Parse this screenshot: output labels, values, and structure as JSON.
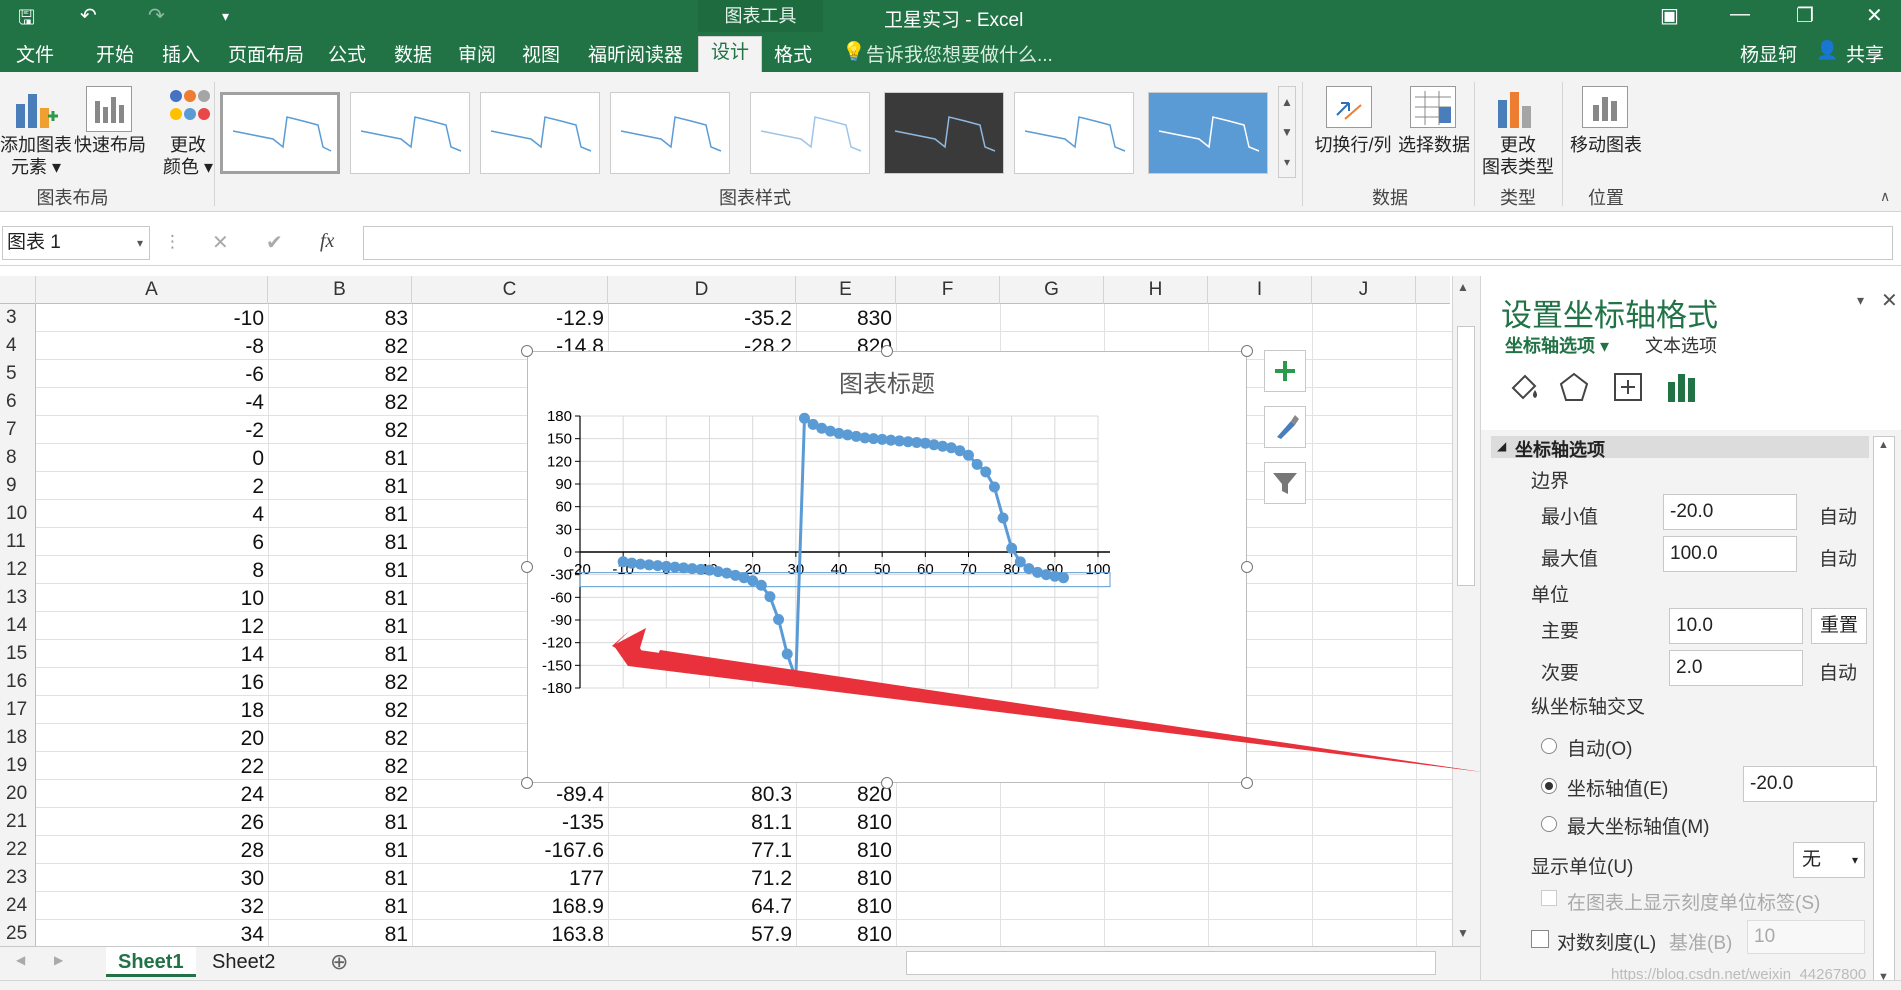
{
  "window": {
    "context_tab_group": "图表工具",
    "app_title": "卫星实习 - Excel",
    "user": "杨显轲",
    "share": "共享"
  },
  "tabs": [
    "文件",
    "开始",
    "插入",
    "页面布局",
    "公式",
    "数据",
    "审阅",
    "视图",
    "福昕阅读器",
    "设计",
    "格式"
  ],
  "tell_me": "告诉我您想要做什么...",
  "ribbon": {
    "add_element_1": "添加图表",
    "add_element_2": "元素",
    "quick_layout": "快速布局",
    "change_colors_1": "更改",
    "change_colors_2": "颜色",
    "group_layout": "图表布局",
    "group_styles": "图表样式",
    "switch_row_col": "切换行/列",
    "select_data": "选择数据",
    "group_data": "数据",
    "change_type_1": "更改",
    "change_type_2": "图表类型",
    "group_type": "类型",
    "move_chart": "移动图表",
    "group_location": "位置"
  },
  "formula_bar": {
    "name_box": "图表 1",
    "fx": "fx"
  },
  "columns": [
    "A",
    "B",
    "C",
    "D",
    "E",
    "F",
    "G",
    "H",
    "I",
    "J"
  ],
  "rows": [
    {
      "n": "3",
      "a": "-10",
      "b": "83",
      "c": "-12.9",
      "d": "-35.2",
      "e": "830"
    },
    {
      "n": "4",
      "a": "-8",
      "b": "82",
      "c": "-14.8",
      "d": "-28.2",
      "e": "820"
    },
    {
      "n": "5",
      "a": "-6",
      "b": "82",
      "c": "",
      "d": "",
      "e": ""
    },
    {
      "n": "6",
      "a": "-4",
      "b": "82",
      "c": "",
      "d": "",
      "e": ""
    },
    {
      "n": "7",
      "a": "-2",
      "b": "82",
      "c": "",
      "d": "",
      "e": ""
    },
    {
      "n": "8",
      "a": "0",
      "b": "81",
      "c": "",
      "d": "",
      "e": ""
    },
    {
      "n": "9",
      "a": "2",
      "b": "81",
      "c": "",
      "d": "",
      "e": ""
    },
    {
      "n": "10",
      "a": "4",
      "b": "81",
      "c": "",
      "d": "",
      "e": ""
    },
    {
      "n": "11",
      "a": "6",
      "b": "81",
      "c": "",
      "d": "",
      "e": ""
    },
    {
      "n": "12",
      "a": "8",
      "b": "81",
      "c": "",
      "d": "",
      "e": ""
    },
    {
      "n": "13",
      "a": "10",
      "b": "81",
      "c": "",
      "d": "",
      "e": ""
    },
    {
      "n": "14",
      "a": "12",
      "b": "81",
      "c": "",
      "d": "",
      "e": ""
    },
    {
      "n": "15",
      "a": "14",
      "b": "81",
      "c": "",
      "d": "",
      "e": ""
    },
    {
      "n": "16",
      "a": "16",
      "b": "82",
      "c": "",
      "d": "",
      "e": ""
    },
    {
      "n": "17",
      "a": "18",
      "b": "82",
      "c": "",
      "d": "",
      "e": ""
    },
    {
      "n": "18",
      "a": "20",
      "b": "82",
      "c": "",
      "d": "",
      "e": ""
    },
    {
      "n": "19",
      "a": "22",
      "b": "82",
      "c": "",
      "d": "",
      "e": ""
    },
    {
      "n": "20",
      "a": "24",
      "b": "82",
      "c": "-89.4",
      "d": "80.3",
      "e": "820"
    },
    {
      "n": "21",
      "a": "26",
      "b": "81",
      "c": "-135",
      "d": "81.1",
      "e": "810"
    },
    {
      "n": "22",
      "a": "28",
      "b": "81",
      "c": "-167.6",
      "d": "77.1",
      "e": "810"
    },
    {
      "n": "23",
      "a": "30",
      "b": "81",
      "c": "177",
      "d": "71.2",
      "e": "810"
    },
    {
      "n": "24",
      "a": "32",
      "b": "81",
      "c": "168.9",
      "d": "64.7",
      "e": "810"
    },
    {
      "n": "25",
      "a": "34",
      "b": "81",
      "c": "163.8",
      "d": "57.9",
      "e": "810"
    }
  ],
  "sheets": [
    "Sheet1",
    "Sheet2"
  ],
  "panel": {
    "title": "设置坐标轴格式",
    "tab_axis_options": "坐标轴选项",
    "tab_text_options": "文本选项",
    "section": "坐标轴选项",
    "bounds": "边界",
    "min_label": "最小值",
    "min_value": "-20.0",
    "max_label": "最大值",
    "max_value": "100.0",
    "auto": "自动",
    "units": "单位",
    "major_label": "主要",
    "major_value": "10.0",
    "reset": "重置",
    "minor_label": "次要",
    "minor_value": "2.0",
    "cross": "纵坐标轴交叉",
    "opt_auto": "自动(O)",
    "opt_value": "坐标轴值(E)",
    "cross_value": "-20.0",
    "opt_max": "最大坐标轴值(M)",
    "display_units": "显示单位(U)",
    "display_units_value": "无",
    "show_units_label": "在图表上显示刻度单位标签(S)",
    "log_scale": "对数刻度(L)",
    "base": "基准(B)",
    "base_value": "10"
  },
  "watermark": "https://blog.csdn.net/weixin_44267800",
  "chart_data": {
    "type": "line",
    "title": "图表标题",
    "xlim": [
      -20,
      100
    ],
    "ylim": [
      -180,
      180
    ],
    "x_ticks": [
      -20,
      -10,
      0,
      10,
      20,
      30,
      40,
      50,
      60,
      70,
      80,
      90,
      100
    ],
    "y_ticks": [
      180,
      150,
      120,
      90,
      60,
      30,
      0,
      -30,
      -60,
      -90,
      -120,
      -150,
      -180
    ],
    "x": [
      -10,
      -8,
      -6,
      -4,
      -2,
      0,
      2,
      4,
      6,
      8,
      10,
      12,
      14,
      16,
      18,
      20,
      22,
      24,
      26,
      28,
      30,
      32,
      34,
      36,
      38,
      40,
      42,
      44,
      46,
      48,
      50,
      52,
      54,
      56,
      58,
      60,
      62,
      64,
      66,
      68,
      70,
      72,
      74,
      76,
      78,
      80,
      82,
      84,
      86,
      88,
      90,
      92
    ],
    "y": [
      -12.9,
      -14.8,
      -16,
      -17,
      -18,
      -19,
      -20,
      -21,
      -22,
      -23,
      -24,
      -26,
      -28,
      -31,
      -34,
      -38,
      -44,
      -59,
      -89.4,
      -135,
      -167.6,
      177,
      168.9,
      163.8,
      160,
      157,
      155,
      153,
      151,
      150,
      149,
      148,
      147,
      146,
      145,
      144,
      142,
      140,
      138,
      134,
      128,
      116,
      106,
      86,
      45,
      5,
      -13,
      -22,
      -27,
      -30,
      -32,
      -34
    ]
  },
  "colors": {
    "excel_green": "#217346",
    "series": "#5b9bd5",
    "annotation_red": "#e8313b"
  }
}
